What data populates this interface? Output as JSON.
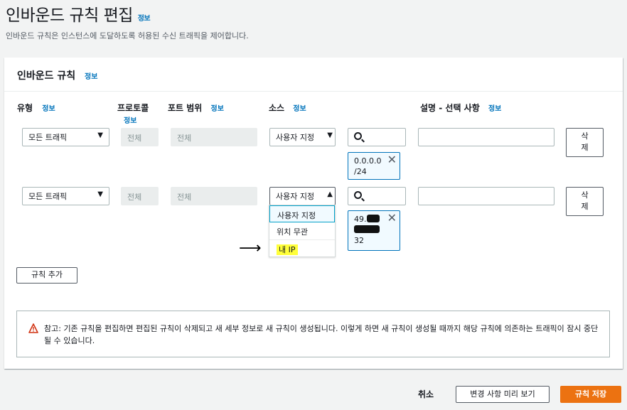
{
  "page": {
    "title": "인바운드 규칙 편집",
    "title_info": "정보",
    "description": "인바운드 규칙은 인스턴스에 도달하도록 허용된 수신 트래픽을 제어합니다."
  },
  "panel": {
    "title": "인바운드 규칙",
    "title_info": "정보"
  },
  "columns": {
    "type": "유형",
    "type_info": "정보",
    "protocol": "프로토콜",
    "protocol_info": "정보",
    "port_range": "포트 범위",
    "port_range_info": "정보",
    "source": "소스",
    "source_info": "정보",
    "description": "설명 - 선택 사항",
    "description_info": "정보"
  },
  "rules": [
    {
      "type": "모든 트래픽",
      "protocol": "전체",
      "port_range": "전체",
      "source": "사용자 지정",
      "source_open": false,
      "token_line1": "0.0.0.0",
      "token_line2": "/24",
      "delete_line1": "삭",
      "delete_line2": "제"
    },
    {
      "type": "모든 트래픽",
      "protocol": "전체",
      "port_range": "전체",
      "source": "사용자 지정",
      "source_open": true,
      "token_line1": "49.",
      "token_line3": "32",
      "delete_line1": "삭",
      "delete_line2": "제"
    }
  ],
  "source_options": [
    "사용자 지정",
    "위치 무관",
    "내 IP"
  ],
  "source_selected": "사용자 지정",
  "source_highlighted": "내 IP",
  "annotation_arrow": "⟶",
  "add_rule": "규칙 추가",
  "alert": {
    "text": "참고: 기존 규칙을 편집하면 편집된 규칙이 삭제되고 새 세부 정보로 새 규칙이 생성됩니다. 이렇게 하면 새 규칙이 생성될 때까지 해당 규칙에 의존하는 트래픽이 잠시 중단될 수 있습니다."
  },
  "footer": {
    "cancel": "취소",
    "preview": "변경 사항 미리 보기",
    "save": "규칙 저장"
  },
  "colors": {
    "accent": "#ec7211",
    "link": "#0073bb",
    "warning": "#d13212",
    "highlight": "#ffff3a"
  },
  "icons": {
    "dropdown_down": "▼",
    "dropdown_up": "▲",
    "remove_token": "✕",
    "warning": "warning-triangle",
    "search": "search-magnifier"
  }
}
